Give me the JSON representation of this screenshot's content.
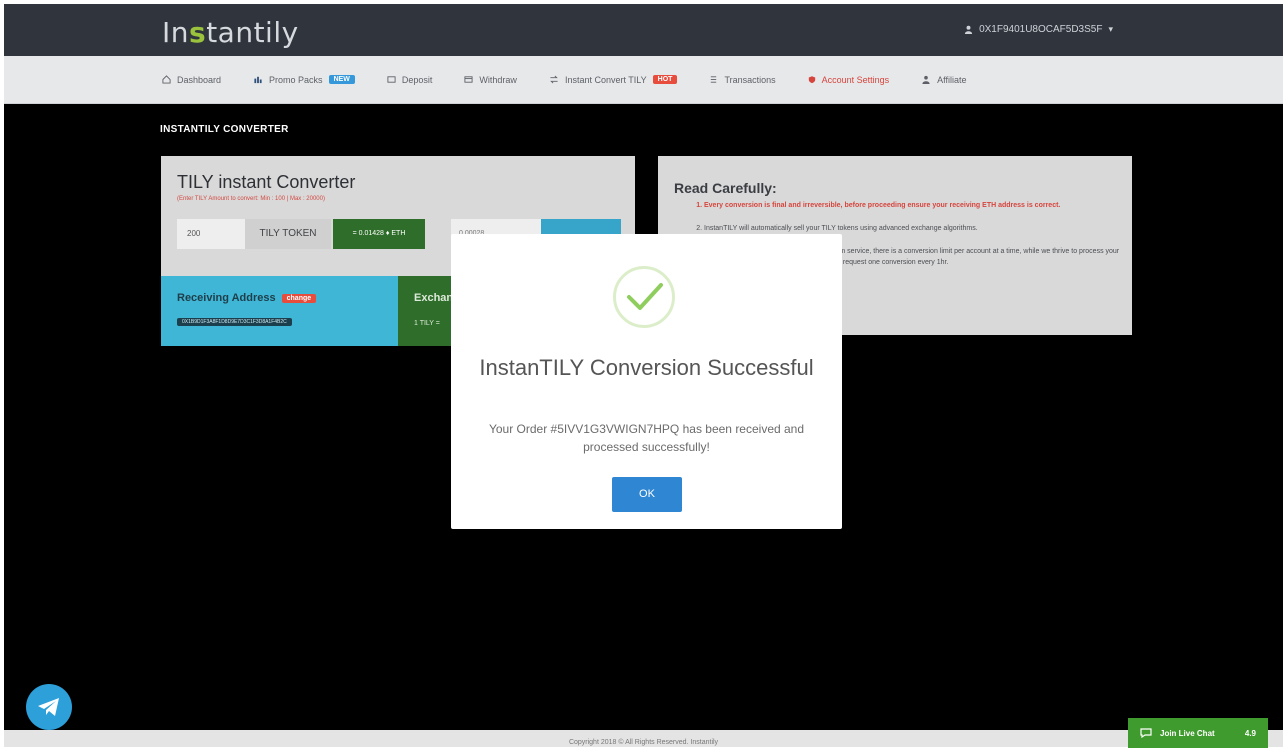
{
  "header": {
    "logo_prefix": "In",
    "logo_mark": "s",
    "logo_suffix": "tantily",
    "user_account": "0X1F9401U8OCAF5D3S5F",
    "caret": "▾"
  },
  "nav": {
    "items": [
      {
        "label": "Dashboard"
      },
      {
        "label": "Promo Packs",
        "badge": "NEW"
      },
      {
        "label": "Deposit"
      },
      {
        "label": "Withdraw"
      },
      {
        "label": "Instant Convert TILY",
        "badge": "HOT"
      },
      {
        "label": "Transactions"
      },
      {
        "label": "Account Settings"
      },
      {
        "label": "Affiliate"
      }
    ]
  },
  "converter": {
    "section_title": "INSTANTILY CONVERTER",
    "panel_title": "TILY instant Converter",
    "hint": "(Enter TILY Amount to convert: Min : 100 | Max : 20000)",
    "amount_value": "200",
    "token_label": "TILY TOKEN",
    "eth_label": "= 0.01428 ♦ ETH",
    "eth_amount_value": "0.00028",
    "receiving_label": "Receiving Address",
    "change_badge": "change",
    "receiving_address": "0X1B9D1F3A8F1D8D9E7D3C1F3D8A1F4B2C",
    "exchange_label": "Exchange Rate",
    "exchange_rate": "1 TILY ="
  },
  "notice": {
    "title": "Read Carefully:",
    "items": [
      "Every conversion is final and irreversible, before proceeding ensure your receiving ETH address is correct.",
      "InstanTILY will automatically sell your TILY tokens using advanced exchange algorithms.",
      "To ensure a fast, secured and smooth system service, there is a conversion limit per account at a time, while we thrive to process your conversion as fast as possible. You can only request one conversion every 1hr."
    ]
  },
  "modal": {
    "title": "InstanTILY Conversion Successful",
    "message": "Your Order #5IVV1G3VWIGN7HPQ has been received and processed successfully!",
    "ok_label": "OK"
  },
  "footer": {
    "copyright": "Copyright 2018 © All Rights Reserved. Instantily"
  },
  "livechat": {
    "label": "Join Live Chat",
    "count": "4.9"
  },
  "colors": {
    "topbar": "#2f343d",
    "accent_green": "#2f6e2a",
    "accent_blue": "#3fb6d6",
    "ok_blue": "#2f86d2",
    "danger": "#d6453d"
  }
}
